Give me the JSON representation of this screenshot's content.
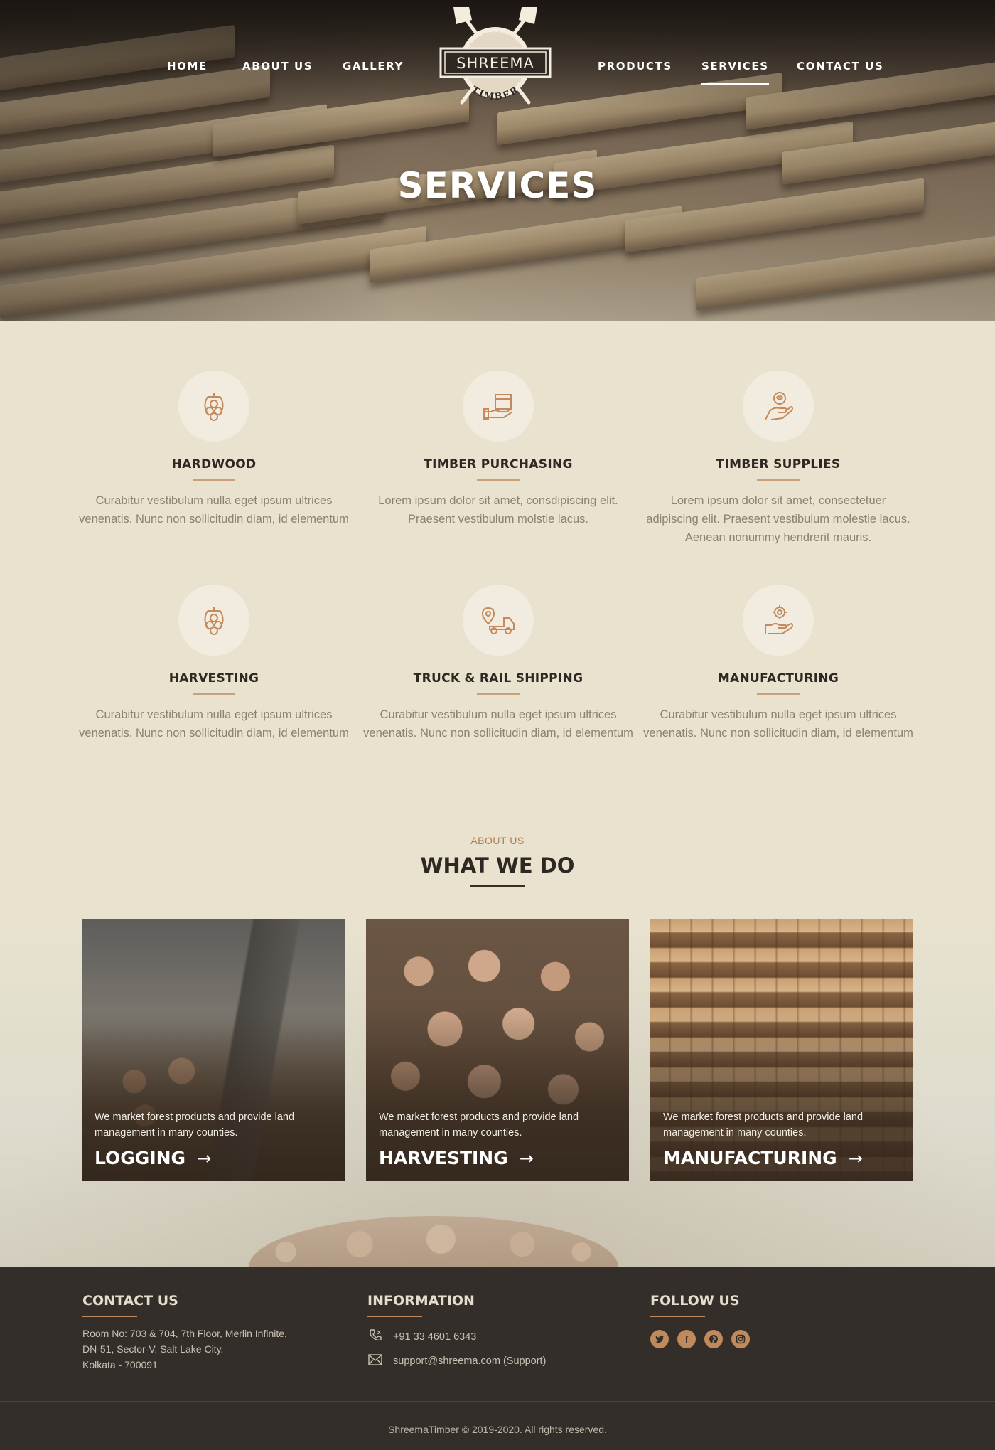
{
  "nav": {
    "home": "HOME",
    "about": "ABOUT US",
    "gallery": "GALLERY",
    "products": "PRODUCTS",
    "services": "SERVICES",
    "contact": "CONTACT US"
  },
  "logo": {
    "brand": "SHREEMA",
    "sub": "TIMBER"
  },
  "hero": {
    "title": "SERVICES"
  },
  "services": [
    {
      "icon": "log-grapple-icon",
      "title": "HARDWOOD",
      "text": "Curabitur vestibulum nulla eget ipsum ultrices venenatis. Nunc non sollicitudin diam, id elementum"
    },
    {
      "icon": "box-on-hand-icon",
      "title": "TIMBER PURCHASING",
      "text": "Lorem ipsum dolor sit amet, consdipiscing elit. Praesent vestibulum molstie lacus."
    },
    {
      "icon": "hand-heart-icon",
      "title": "TIMBER SUPPLIES",
      "text": "Lorem ipsum dolor sit amet, consectetuer adipiscing elit. Praesent vestibulum molestie lacus. Aenean nonummy hendrerit mauris."
    },
    {
      "icon": "log-grapple-icon",
      "title": "HARVESTING",
      "text": "Curabitur vestibulum nulla eget ipsum ultrices venenatis. Nunc non sollicitudin diam, id elementum"
    },
    {
      "icon": "delivery-truck-icon",
      "title": "TRUCK & RAIL SHIPPING",
      "text": "Curabitur vestibulum nulla eget ipsum ultrices venenatis. Nunc non sollicitudin diam, id elementum"
    },
    {
      "icon": "hand-gear-icon",
      "title": "MANUFACTURING",
      "text": "Curabitur vestibulum nulla eget ipsum ultrices venenatis. Nunc non sollicitudin diam, id elementum"
    }
  ],
  "about": {
    "eyebrow": "ABOUT US",
    "title": "WHAT WE DO"
  },
  "cards": [
    {
      "title": "LOGGING",
      "text": "We market forest products and provide land management in many counties."
    },
    {
      "title": "HARVESTING",
      "text": "We market forest products and provide land management in many counties."
    },
    {
      "title": "MANUFACTURING",
      "text": "We market forest products and provide land management in many counties."
    }
  ],
  "footer": {
    "contact_title": "CONTACT US",
    "address_line1": "Room No: 703 & 704, 7th Floor, Merlin Infinite,",
    "address_line2": "DN-51, Sector-V, Salt Lake City,",
    "address_line3": "Kolkata - 700091",
    "info_title": "INFORMATION",
    "phone": "+91 33 4601 6343",
    "email": "support@shreema.com (Support)",
    "follow_title": "FOLLOW US",
    "copyright": "ShreemaTimber © 2019-2020. All rights reserved."
  },
  "colors": {
    "accent": "#c08a5d",
    "background": "#e8e2cf",
    "footer": "#332e29"
  }
}
